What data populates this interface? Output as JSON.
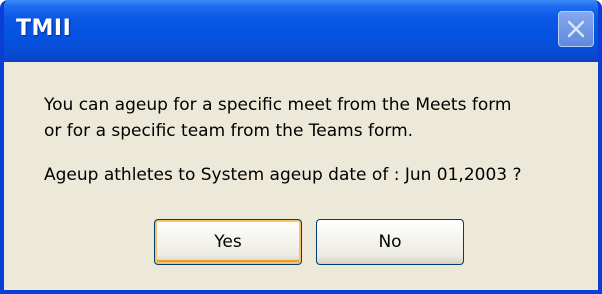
{
  "window": {
    "title": "TMII"
  },
  "dialog": {
    "message_line1": "You can ageup for a specific meet from the Meets form",
    "message_line2": "or for a specific team from the Teams form.",
    "question": "Ageup athletes to System ageup date of : Jun 01,2003 ?"
  },
  "buttons": {
    "yes_label": "Yes",
    "no_label": "No"
  },
  "icons": {
    "close": "close-icon"
  },
  "colors": {
    "titlebar": "#0552e0",
    "window_border": "#0a3fd6",
    "dialog_background": "#ece9d8",
    "default_button_highlight": "#f6c36a"
  }
}
